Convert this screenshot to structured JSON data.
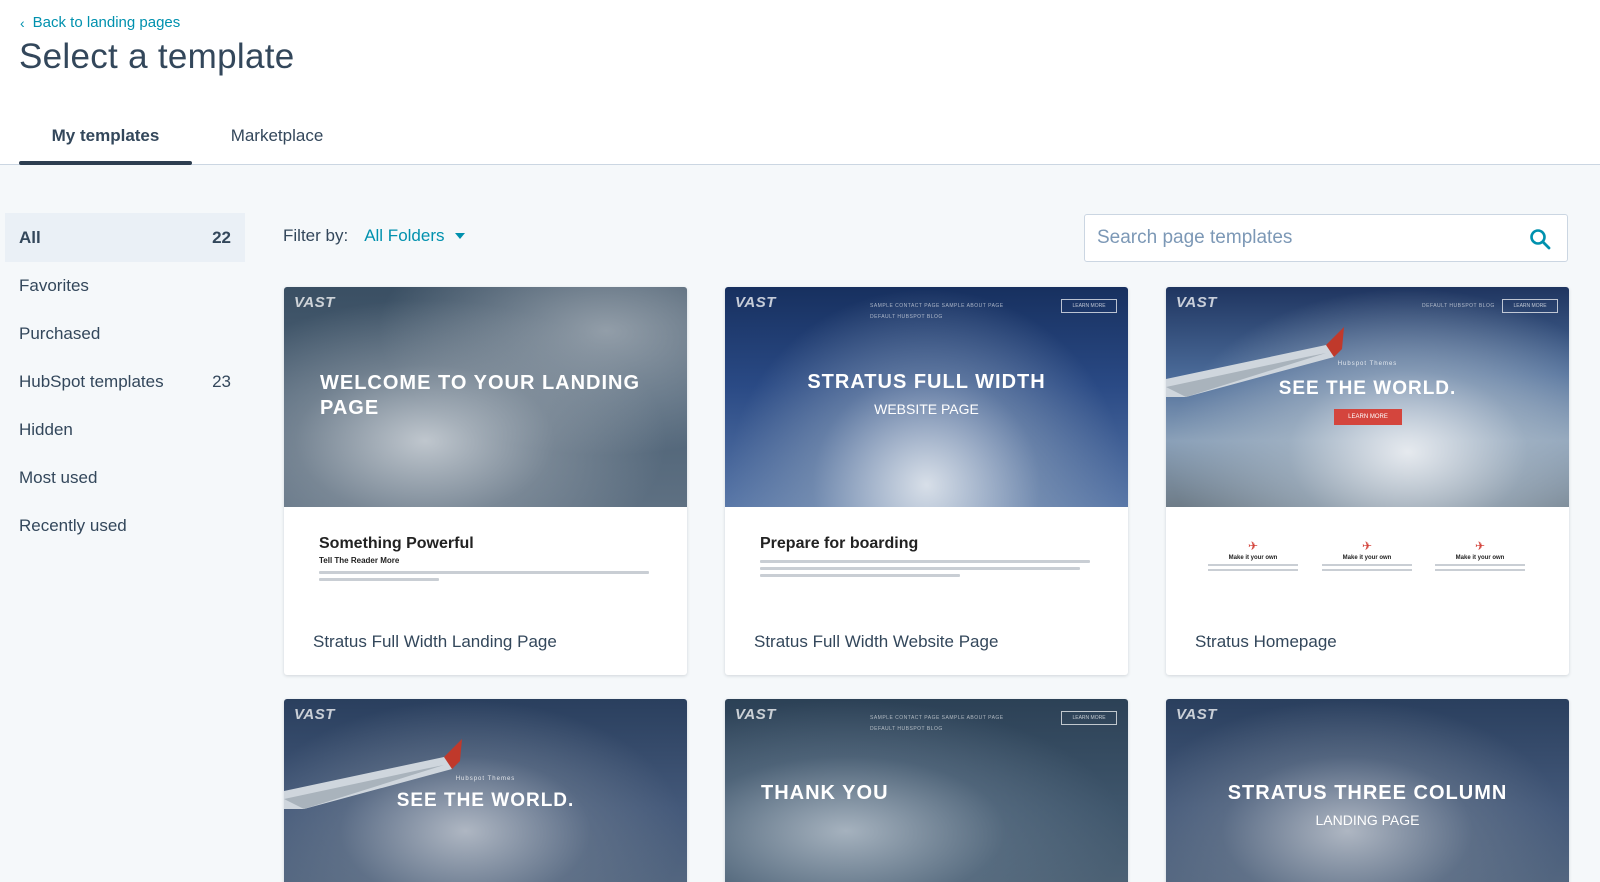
{
  "header": {
    "back_label": "Back to landing pages",
    "title": "Select a template",
    "tabs": [
      {
        "label": "My templates",
        "active": true
      },
      {
        "label": "Marketplace",
        "active": false
      }
    ]
  },
  "sidebar": {
    "items": [
      {
        "label": "All",
        "count": "22",
        "active": true
      },
      {
        "label": "Favorites",
        "count": ""
      },
      {
        "label": "Purchased",
        "count": ""
      },
      {
        "label": "HubSpot templates",
        "count": "23"
      },
      {
        "label": "Hidden",
        "count": ""
      },
      {
        "label": "Most used",
        "count": ""
      },
      {
        "label": "Recently used",
        "count": ""
      }
    ]
  },
  "filter": {
    "label": "Filter by:",
    "value": "All Folders"
  },
  "search": {
    "placeholder": "Search page templates",
    "icon": "search-icon"
  },
  "cards": [
    {
      "name": "Stratus Full Width Landing Page",
      "thumb_logo": "VAST",
      "thumb_title": "WELCOME TO YOUR LANDING PAGE",
      "sample_heading": "Something Powerful",
      "sample_sub": "Tell The Reader More"
    },
    {
      "name": "Stratus Full Width Website Page",
      "thumb_logo": "VAST",
      "thumb_title": "STRATUS FULL WIDTH",
      "thumb_subtitle": "WEBSITE PAGE",
      "nav_links": "SAMPLE CONTACT PAGE    SAMPLE ABOUT PAGE",
      "nav_links2": "DEFAULT HUBSPOT BLOG",
      "nav_button": "LEARN MORE",
      "sample_heading": "Prepare for boarding"
    },
    {
      "name": "Stratus Homepage",
      "thumb_logo": "VAST",
      "thumb_kicker": "Hubspot Themes",
      "thumb_title": "SEE THE WORLD.",
      "thumb_button": "LEARN MORE",
      "nav_links": "DEFAULT HUBSPOT BLOG",
      "nav_button": "LEARN MORE",
      "feature_label": "Make it your own"
    },
    {
      "name": "",
      "thumb_logo": "VAST",
      "thumb_kicker": "Hubspot Themes",
      "thumb_title": "SEE THE WORLD."
    },
    {
      "name": "",
      "thumb_logo": "VAST",
      "thumb_title": "THANK YOU",
      "nav_links": "SAMPLE CONTACT PAGE    SAMPLE ABOUT PAGE",
      "nav_links2": "DEFAULT HUBSPOT BLOG",
      "nav_button": "LEARN MORE"
    },
    {
      "name": "",
      "thumb_logo": "VAST",
      "thumb_title": "STRATUS THREE COLUMN",
      "thumb_subtitle": "LANDING PAGE"
    }
  ],
  "colors": {
    "accent": "#0091ae",
    "text": "#33475b",
    "background": "#f5f8fa",
    "tab_indicator": "#2d3e50",
    "brand_red": "#d4453d"
  }
}
